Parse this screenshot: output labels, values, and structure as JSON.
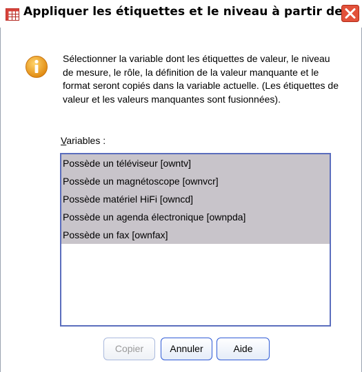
{
  "window": {
    "title": "Appliquer les étiquettes et le niveau à partir de"
  },
  "icons": {
    "title": "data-grid-icon",
    "close": "close-icon",
    "info": "info-icon"
  },
  "message": {
    "text": "Sélectionner la variable dont les étiquettes de valeur, le niveau de mesure, le rôle, la définition de la valeur manquante et le format seront copiés dans la variable actuelle. (Les étiquettes de valeur et les valeurs manquantes sont fusionnées)."
  },
  "variables": {
    "label_accel": "V",
    "label_rest": "ariables :",
    "items": [
      "Possède un téléviseur [owntv]",
      "Possède un magnétoscope [ownvcr]",
      "Possède matériel HiFi [owncd]",
      "Possède un agenda électronique [ownpda]",
      "Possède un fax [ownfax]"
    ]
  },
  "buttons": {
    "copy": "Copier",
    "cancel": "Annuler",
    "help": "Aide"
  },
  "colors": {
    "selection": "#c8c4ca",
    "list_border": "#5a6dbd",
    "close_button": "#e2513a",
    "info_icon": "#f0a020",
    "button_border": "#2f5bd6"
  }
}
